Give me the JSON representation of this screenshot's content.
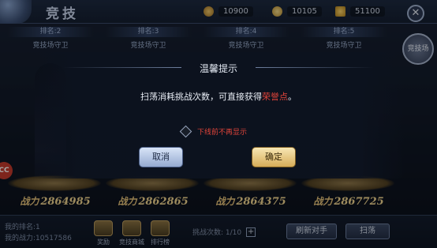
{
  "header": {
    "title": "竞技",
    "resources": [
      {
        "icon": "rank-badge-icon",
        "value": "10900"
      },
      {
        "icon": "coin-icon",
        "value": "10105"
      },
      {
        "icon": "crown-icon",
        "value": "51100"
      }
    ],
    "close_label": "✕"
  },
  "rank_cards": [
    {
      "rank": "排名:2",
      "name": "竞技场守卫"
    },
    {
      "rank": "排名:3",
      "name": "竞技场守卫"
    },
    {
      "rank": "排名:4",
      "name": "竞技场守卫"
    },
    {
      "rank": "排名:5",
      "name": "竞技场守卫"
    }
  ],
  "side_medal": {
    "label": "竞技场"
  },
  "opponents": [
    {
      "power_label": "战力",
      "power": "2864985"
    },
    {
      "power_label": "战力",
      "power": "2862865"
    },
    {
      "power_label": "战力",
      "power": "2864375"
    },
    {
      "power_label": "战力",
      "power": "2867725"
    }
  ],
  "bottom": {
    "my_rank": "我的排名:1",
    "my_power": "我的战力:10517586",
    "shortcuts": [
      {
        "label": "奖励"
      },
      {
        "label": "竞技商城"
      },
      {
        "label": "排行榜"
      }
    ],
    "challenge_count": "挑战次数: 1/10",
    "refresh_label": "刷新对手",
    "sweep_label": "扫荡"
  },
  "side_badge": "CC",
  "dialog": {
    "title": "温馨提示",
    "message_prefix": "扫荡消耗挑战次数，可直接获得",
    "message_highlight": "荣誉点",
    "message_suffix": "。",
    "dont_show_label": "下线前不再显示",
    "cancel_label": "取消",
    "confirm_label": "确定"
  },
  "colors": {
    "highlight": "#e0443a",
    "confirm_button": "#d6ac59",
    "cancel_button": "#95aad0"
  }
}
